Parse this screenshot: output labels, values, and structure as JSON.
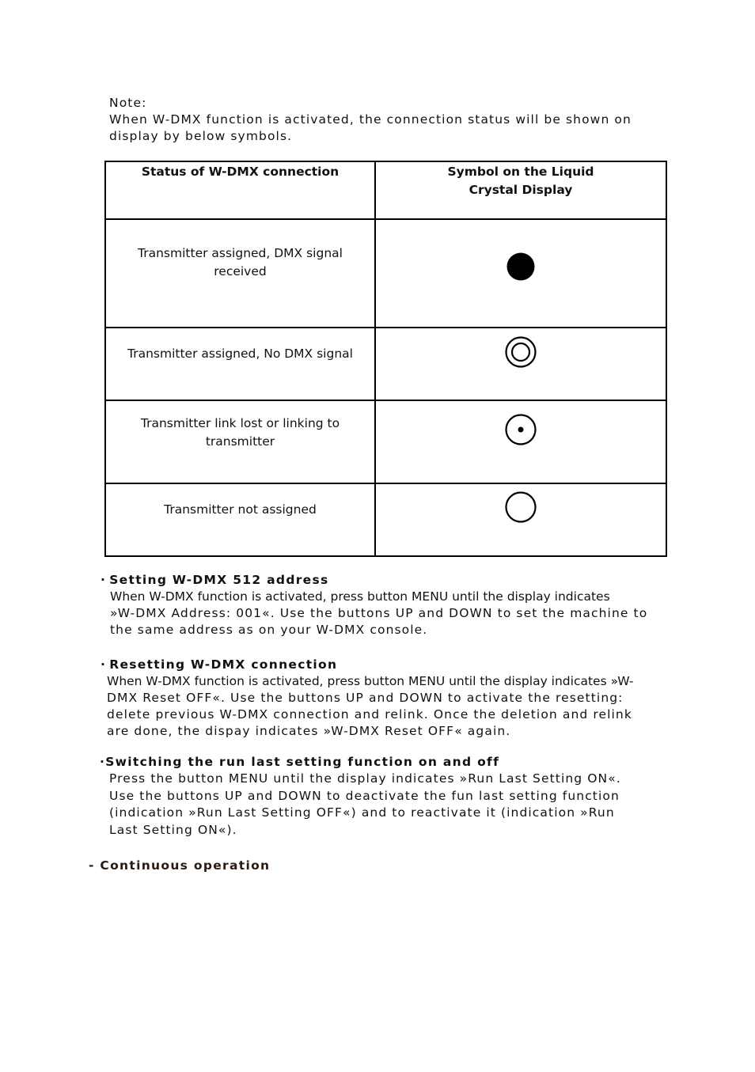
{
  "note": {
    "label": "Note:",
    "lines": [
      "When W-DMX function is activated, the connection status will be shown on",
      "display by below symbols."
    ]
  },
  "table": {
    "headers": {
      "status": "Status of W-DMX connection",
      "symbol": "Symbol on the Liquid Crystal Display"
    },
    "rows": [
      {
        "status": "Transmitter assigned, DMX signal received",
        "symbol_icon": "filled-circle-icon"
      },
      {
        "status": "Transmitter assigned, No DMX signal",
        "symbol_icon": "double-ring-icon"
      },
      {
        "status": "Transmitter link lost or linking to transmitter",
        "symbol_icon": "dotted-circle-icon"
      },
      {
        "status": "Transmitter not assigned",
        "symbol_icon": "empty-circle-icon"
      }
    ]
  },
  "sections": {
    "address": {
      "bullet": "·",
      "heading": "Setting W-DMX 512 address",
      "lines": [
        "When W-DMX function is activated, press button MENU until the display indicates",
        "»W-DMX Address: 001«. Use the buttons UP and DOWN to set the machine to",
        "the same address as on your W-DMX console."
      ]
    },
    "reset": {
      "bullet": "·",
      "heading": "Resetting W-DMX connection",
      "lines": [
        "When W-DMX function is activated, press button MENU until the display indicates »W-",
        "DMX Reset OFF«. Use the buttons UP and DOWN to activate the resetting:",
        "delete previous W-DMX connection and relink. Once the deletion and relink",
        "are done, the dispay indicates »W-DMX Reset OFF« again."
      ]
    },
    "runlast": {
      "bullet": "·",
      "heading": "Switching the run last setting function on and off",
      "lines": [
        "Press the button MENU until the display indicates »Run Last Setting ON«.",
        "Use the buttons UP and DOWN to deactivate the fun last setting function",
        "(indication »Run Last Setting OFF«) and to reactivate it (indication »Run",
        "Last Setting ON«)."
      ]
    },
    "continuous": {
      "heading": "- Continuous operation"
    }
  }
}
